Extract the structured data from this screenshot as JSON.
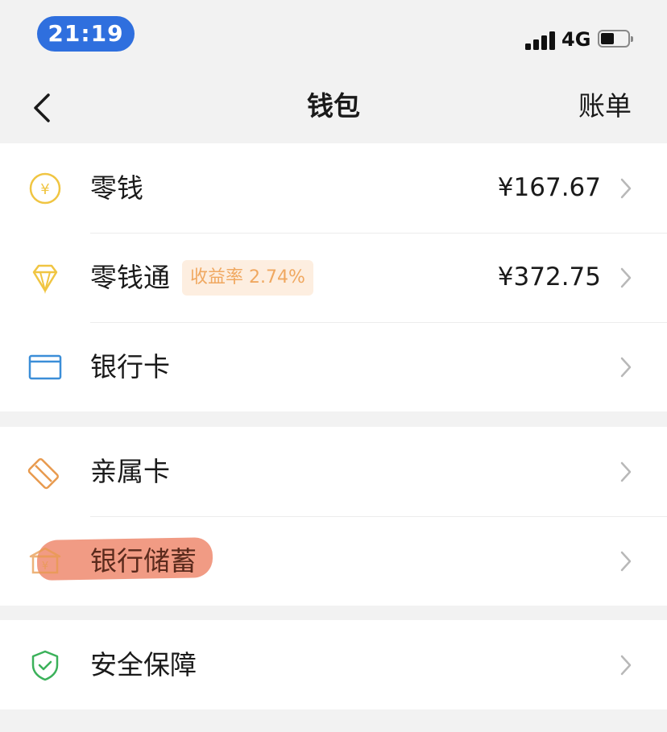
{
  "status_bar": {
    "time": "21:19",
    "network": "4G",
    "signal_icon": "signal-bars-icon",
    "battery_icon": "battery-icon"
  },
  "nav": {
    "back_icon": "chevron-left-icon",
    "title": "钱包",
    "bill_label": "账单"
  },
  "groups": [
    {
      "items": [
        {
          "label": "零钱",
          "value": "¥167.67",
          "icon": "yuan-coin-icon",
          "icon_color": "#f0c542"
        },
        {
          "label": "零钱通",
          "badge": "收益率 2.74%",
          "value": "¥372.75",
          "icon": "diamond-icon",
          "icon_color": "#f0c542"
        },
        {
          "label": "银行卡",
          "icon": "bank-card-icon",
          "icon_color": "#3b8ed8"
        }
      ]
    },
    {
      "items": [
        {
          "label": "亲属卡",
          "icon": "family-card-icon",
          "icon_color": "#e89a4e"
        },
        {
          "label": "银行储蓄",
          "icon": "bank-savings-icon",
          "icon_color": "#e89a4e",
          "highlighted": true
        }
      ]
    },
    {
      "items": [
        {
          "label": "安全保障",
          "icon": "shield-check-icon",
          "icon_color": "#3bb15a"
        }
      ]
    }
  ],
  "colors": {
    "time_pill": "#2f6fde",
    "badge_bg": "#fdeee0",
    "badge_text": "#f0a860",
    "highlight_marker": "#ef8a6e",
    "chevron": "#b8b8b8"
  }
}
